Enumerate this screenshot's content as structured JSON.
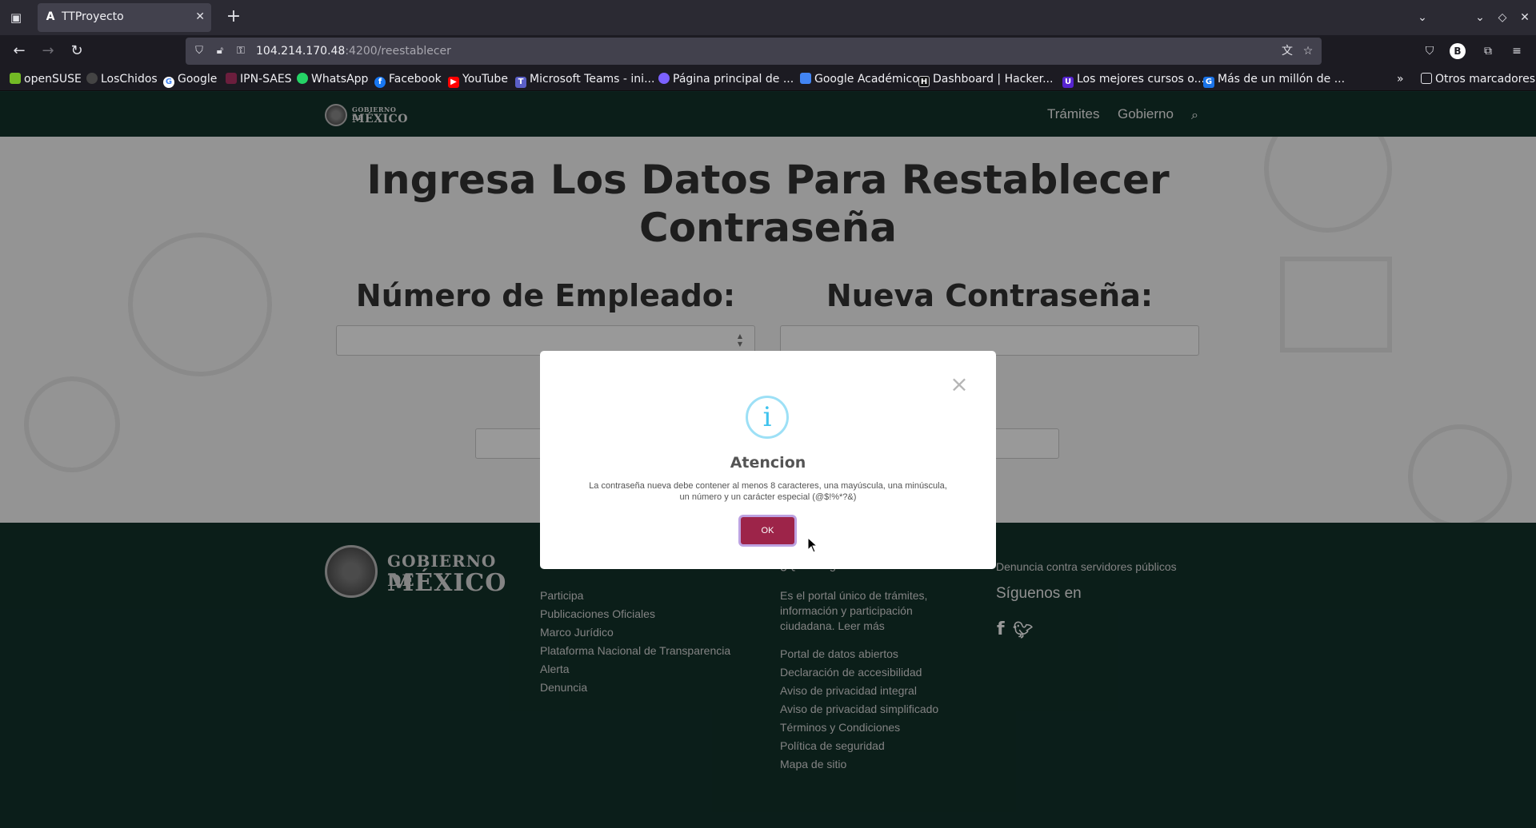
{
  "browser": {
    "tab": {
      "title": "TTProyecto",
      "favicon": "A"
    },
    "url": {
      "host": "104.214.170.48",
      "rest": ":4200/reestablecer"
    },
    "bookmarks": [
      {
        "label": "openSUSE",
        "color": "#73ba25"
      },
      {
        "label": "LosChidos",
        "color": "#444"
      },
      {
        "label": "Google",
        "color": "#4285f4"
      },
      {
        "label": "IPN-SAES",
        "color": "#6b1e3d"
      },
      {
        "label": "WhatsApp",
        "color": "#25d366"
      },
      {
        "label": "Facebook",
        "color": "#1877f2"
      },
      {
        "label": "YouTube",
        "color": "#ff0000"
      },
      {
        "label": "Microsoft Teams - ini...",
        "color": "#5b5fc7"
      },
      {
        "label": "Página principal de ...",
        "color": "#7b61ff"
      },
      {
        "label": "Google Académico",
        "color": "#4285f4"
      },
      {
        "label": "Dashboard | Hacker...",
        "color": "#111"
      },
      {
        "label": "Los mejores cursos o...",
        "color": "#5624d0"
      },
      {
        "label": "Más de un millón de ...",
        "color": "#1a73e8"
      }
    ],
    "other_bookmarks": "Otros marcadores"
  },
  "site": {
    "header": {
      "logo_line1": "GOBIERNO DE",
      "logo_line2": "MÉXICO",
      "links": [
        "Trámites",
        "Gobierno"
      ]
    },
    "main": {
      "title_line1": "Ingresa Los Datos Para Restablecer",
      "title_line2": "Contraseña",
      "employee_label": "Número de Empleado:",
      "password_label": "Nueva Contraseña:"
    },
    "footer": {
      "logo_line1": "GOBIERNO DE",
      "logo_line2": "MÉXICO",
      "col1_links": [
        "Participa",
        "Publicaciones Oficiales",
        "Marco Jurídico",
        "Plataforma Nacional de Transparencia",
        "Alerta",
        "Denuncia"
      ],
      "col2_heading": "¿Qué es gob.mx?",
      "col2_text": "Es el portal único de trámites, información y participación ciudadana. Leer más",
      "col2_links": [
        "Portal de datos abiertos",
        "Declaración de accesibilidad",
        "Aviso de privacidad integral",
        "Aviso de privacidad simplificado",
        "Términos y Condiciones",
        "Política de seguridad",
        "Mapa de sitio"
      ],
      "col3_link": "Denuncia contra servidores públicos",
      "col3_follow": "Síguenos en",
      "social": [
        "f",
        "t"
      ]
    }
  },
  "modal": {
    "title": "Atencion",
    "message": "La contraseña nueva debe contener al menos 8 caracteres, una mayúscula, una minúscula, un número y un carácter especial (@$!%*?&)",
    "ok_label": "OK",
    "icon": "i"
  },
  "colors": {
    "header": "#13322b",
    "accent": "#9d2449",
    "info_icon": "#3fc3ee"
  }
}
